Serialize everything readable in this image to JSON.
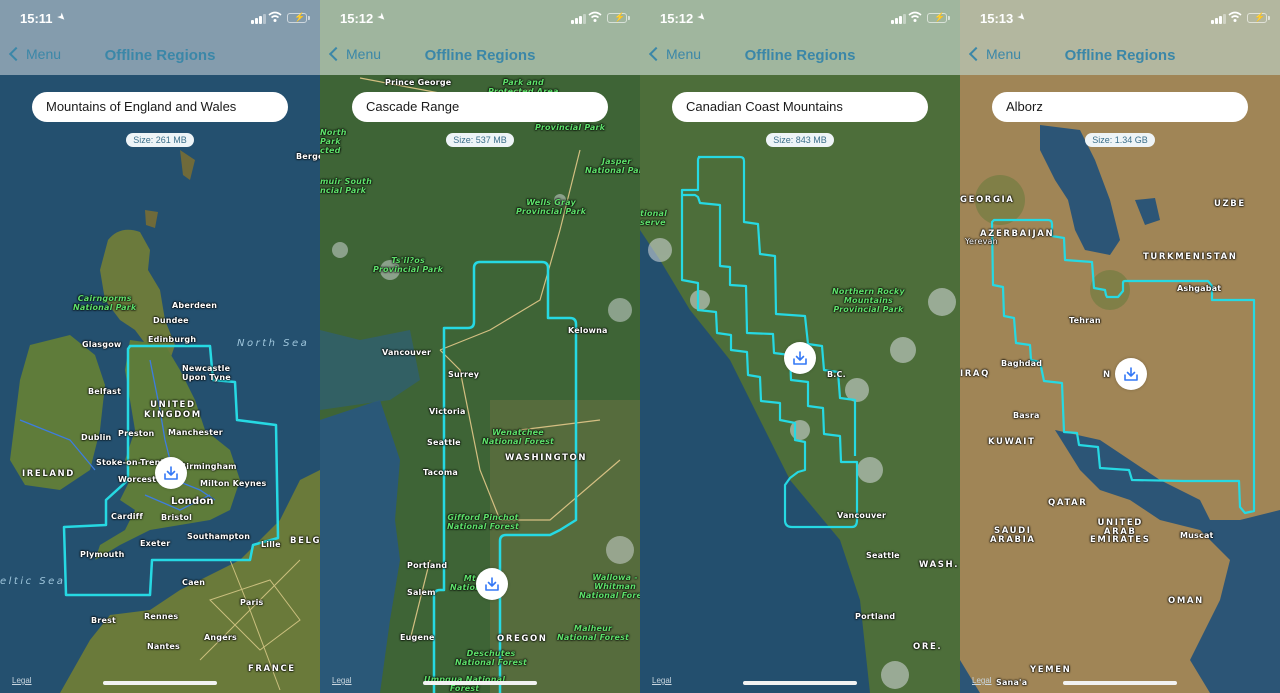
{
  "app": {
    "back_label": "Menu",
    "title": "Offline Regions"
  },
  "colors": {
    "accent": "#3b87a8",
    "region_outline": "#26d9e3",
    "download_icon": "#3478f6",
    "battery": "#35d04a"
  },
  "icons": {
    "back": "chevron-left-icon",
    "download": "download-tray-icon",
    "location": "location-arrow-icon",
    "signal": "cellular-signal-icon",
    "wifi": "wifi-icon",
    "battery": "battery-charging-icon"
  },
  "screens": [
    {
      "time": "15:11",
      "region_name": "Mountains of England and Wales",
      "size": "Size: 261 MB",
      "legal": "Legal",
      "labels": {
        "bergen": "Berge",
        "cairngorms": "Cairngorms\nNational Park",
        "aberdeen": "Aberdeen",
        "dundee": "Dundee",
        "edinburgh": "Edinburgh",
        "glasgow": "Glasgow",
        "north_sea": "North Sea",
        "newcastle": "Newcastle\nUpon Tyne",
        "belfast": "Belfast",
        "uk": "UNITED\nKINGDOM",
        "preston": "Preston",
        "manchester": "Manchester",
        "dublin": "Dublin",
        "stoke": "Stoke-on-Trent",
        "birmingham": "Birmingham",
        "ireland": "IRELAND",
        "worcester": "Worcester",
        "milton_keynes": "Milton Keynes",
        "london": "London",
        "cardiff": "Cardiff",
        "bristol": "Bristol",
        "exeter": "Exeter",
        "southampton": "Southampton",
        "plymouth": "Plymouth",
        "celtic_sea": "eltic Sea",
        "lille": "Lille",
        "belgium": "BELGI",
        "caen": "Caen",
        "paris": "Paris",
        "brest": "Brest",
        "rennes": "Rennes",
        "angers": "Angers",
        "nantes": "Nantes",
        "france": "FRANCE"
      }
    },
    {
      "time": "15:12",
      "region_name": "Cascade Range",
      "size": "Size: 537 MB",
      "legal": "Legal",
      "labels": {
        "prince_george": "Prince George",
        "park_protected": "Park and\nProtected Area",
        "north_park": "North\nPark\ncted",
        "provincial_park": "Provincial Park",
        "jasper": "Jasper\nNational Park",
        "muir_south": "muir South\nncial Park",
        "wells_gray": "Wells Gray\nProvincial Park",
        "tsilhqot": "Ts'il?os\nProvincial Park",
        "kelowna": "Kelowna",
        "vancouver": "Vancouver",
        "surrey": "Surrey",
        "victoria": "Victoria",
        "seattle": "Seattle",
        "wenatchee": "Wenatchee\nNational Forest",
        "washington": "WASHINGTON",
        "tacoma": "Tacoma",
        "gifford": "Gifford Pinchot\nNational Forest",
        "portland": "Portland",
        "mt_hood": "Mt\nNational",
        "salem": "Salem",
        "wallowa": "Wallowa -\nWhitman\nNational Forest",
        "eugene": "Eugene",
        "oregon": "OREGON",
        "malheur": "Malheur\nNational Forest",
        "deschutes": "Deschutes\nNational Forest",
        "umpqua": "Umpqua National\nForest"
      }
    },
    {
      "time": "15:12",
      "region_name": "Canadian Coast Mountains",
      "size": "Size: 843 MB",
      "legal": "Legal",
      "labels": {
        "national_reserve": "tional\nserve",
        "northern_rocky": "Northern Rocky\nMountains\nProvincial Park",
        "bc": "B.C.",
        "vancouver": "Vancouver",
        "seattle": "Seattle",
        "wash": "WASH.",
        "portland": "Portland",
        "ore": "ORE."
      }
    },
    {
      "time": "15:13",
      "region_name": "Alborz",
      "size": "Size: 1.34 GB",
      "legal": "Legal",
      "labels": {
        "georgia": "GEORGIA",
        "uzbek": "UZBE",
        "azerbaijan": "AZERBAIJAN",
        "yerevan": "Yerevan",
        "turkmenistan": "TURKMENISTAN",
        "ashgabat": "Ashgabat",
        "tehran": "Tehran",
        "baghdad": "Baghdad",
        "iraq": "IRAQ",
        "iran": "N",
        "basra": "Basra",
        "kuwait": "KUWAIT",
        "qatar": "QATAR",
        "uae": "UNITED\nARAB\nEMIRATES",
        "saudi": "SAUDI\nARABIA",
        "muscat": "Muscat",
        "oman": "OMAN",
        "yemen": "YEMEN",
        "sanaa": "Sana'a"
      }
    }
  ]
}
